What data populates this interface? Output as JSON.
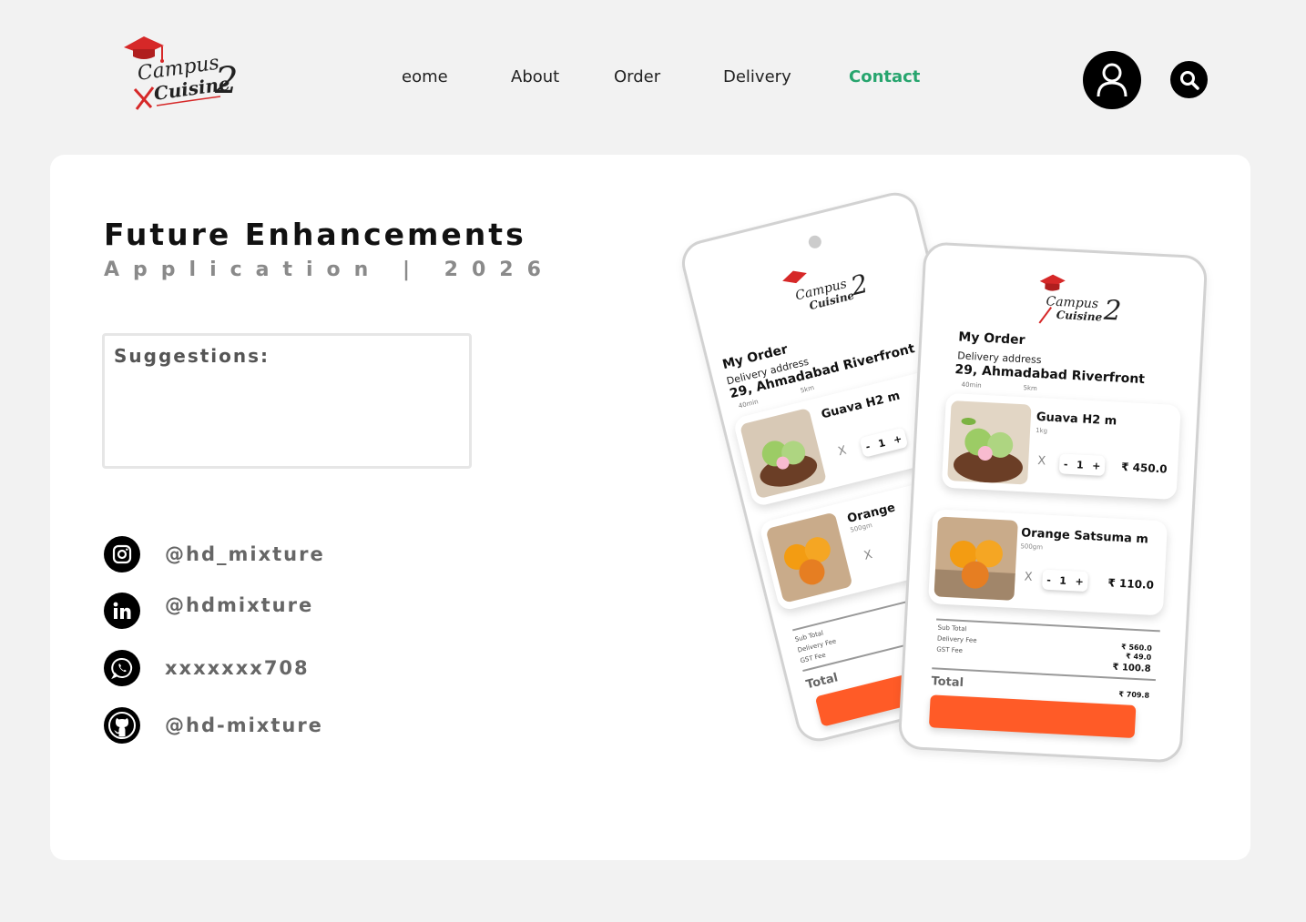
{
  "brand": {
    "line1": "Campus",
    "line2": "Cuisine",
    "number": "2",
    "color": "#d62828"
  },
  "nav": {
    "items": [
      {
        "label": "eome",
        "active": false
      },
      {
        "label": "About",
        "active": false
      },
      {
        "label": "Order",
        "active": false
      },
      {
        "label": "Delivery",
        "active": false
      },
      {
        "label": "Contact",
        "active": true
      }
    ],
    "active_color": "#27a56e"
  },
  "header": {
    "user_icon": "user-icon",
    "search_icon": "search-icon"
  },
  "main": {
    "title": "Future Enhancements",
    "subtitle": "Application | 2026",
    "suggestions_label": "Suggestions:"
  },
  "social": [
    {
      "icon": "instagram-icon",
      "handle": "@hd_mixture"
    },
    {
      "icon": "linkedin-icon",
      "handle": "@hdmixture"
    },
    {
      "icon": "whatsapp-icon",
      "handle": "xxxxxxx708"
    },
    {
      "icon": "github-icon",
      "handle": "@hd-mixture"
    }
  ],
  "phone": {
    "my_order": "My Order",
    "delivery_label": "Delivery address",
    "address": "29, Ahmadabad Riverfront",
    "time": "40min",
    "distance": "5km",
    "items": [
      {
        "name": "Guava H2 m",
        "weight": "1kg",
        "x": "X",
        "minus": "-",
        "qty": "1",
        "plus": "+",
        "price": "₹ 450.0"
      },
      {
        "name": "Orange Satsuma m",
        "weight": "500gm",
        "x": "X",
        "minus": "-",
        "qty": "1",
        "plus": "+",
        "price": "₹ 110.0"
      }
    ],
    "summary": {
      "sub_total_label": "Sub Total",
      "delivery_fee_label": "Delivery Fee",
      "gst_fee_label": "GST Fee",
      "sub_total": "₹ 560.0",
      "delivery_fee": "₹ 49.0",
      "gst_fee": "₹ 100.8",
      "total_label": "Total",
      "total": "₹ 709.8"
    },
    "button_color": "#ff5b27"
  },
  "back_phone": {
    "item1_name": "Guava H2 m",
    "item2_name": "Orange",
    "item2_weight": "500gm"
  }
}
